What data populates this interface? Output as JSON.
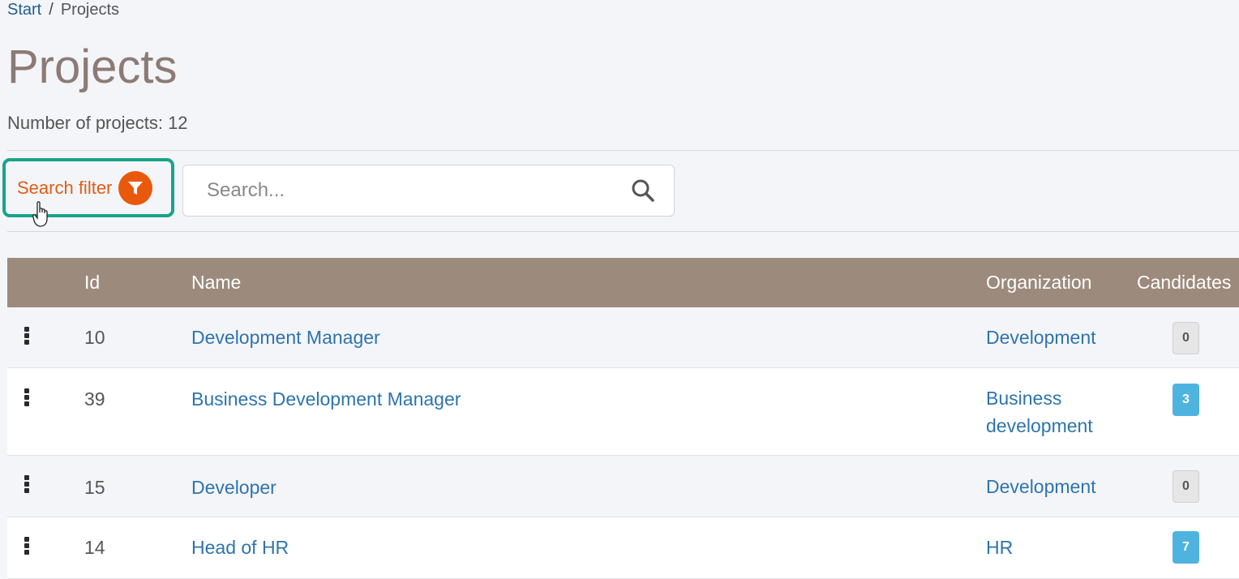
{
  "breadcrumb": {
    "home": "Start",
    "separator": "/",
    "current": "Projects"
  },
  "page": {
    "title": "Projects",
    "count_text": "Number of projects: 12"
  },
  "filter": {
    "label": "Search filter",
    "icon": "filter-icon",
    "color": "#e8590c",
    "highlight_color": "#1aa48a"
  },
  "search": {
    "placeholder": "Search...",
    "value": ""
  },
  "table": {
    "headers": {
      "id": "Id",
      "name": "Name",
      "organization": "Organization",
      "candidates": "Candidates"
    },
    "rows": [
      {
        "id": "10",
        "name": "Development Manager",
        "organization": "Development",
        "candidates": "0"
      },
      {
        "id": "39",
        "name": "Business Development Manager",
        "organization": "Business development",
        "candidates": "3"
      },
      {
        "id": "15",
        "name": "Developer",
        "organization": "Development",
        "candidates": "0"
      },
      {
        "id": "14",
        "name": "Head of HR",
        "organization": "HR",
        "candidates": "7"
      }
    ]
  },
  "colors": {
    "header_bg": "#9c8a7d",
    "link": "#2e74ad",
    "badge_active": "#4fb3e0",
    "title": "#8c7b74"
  }
}
